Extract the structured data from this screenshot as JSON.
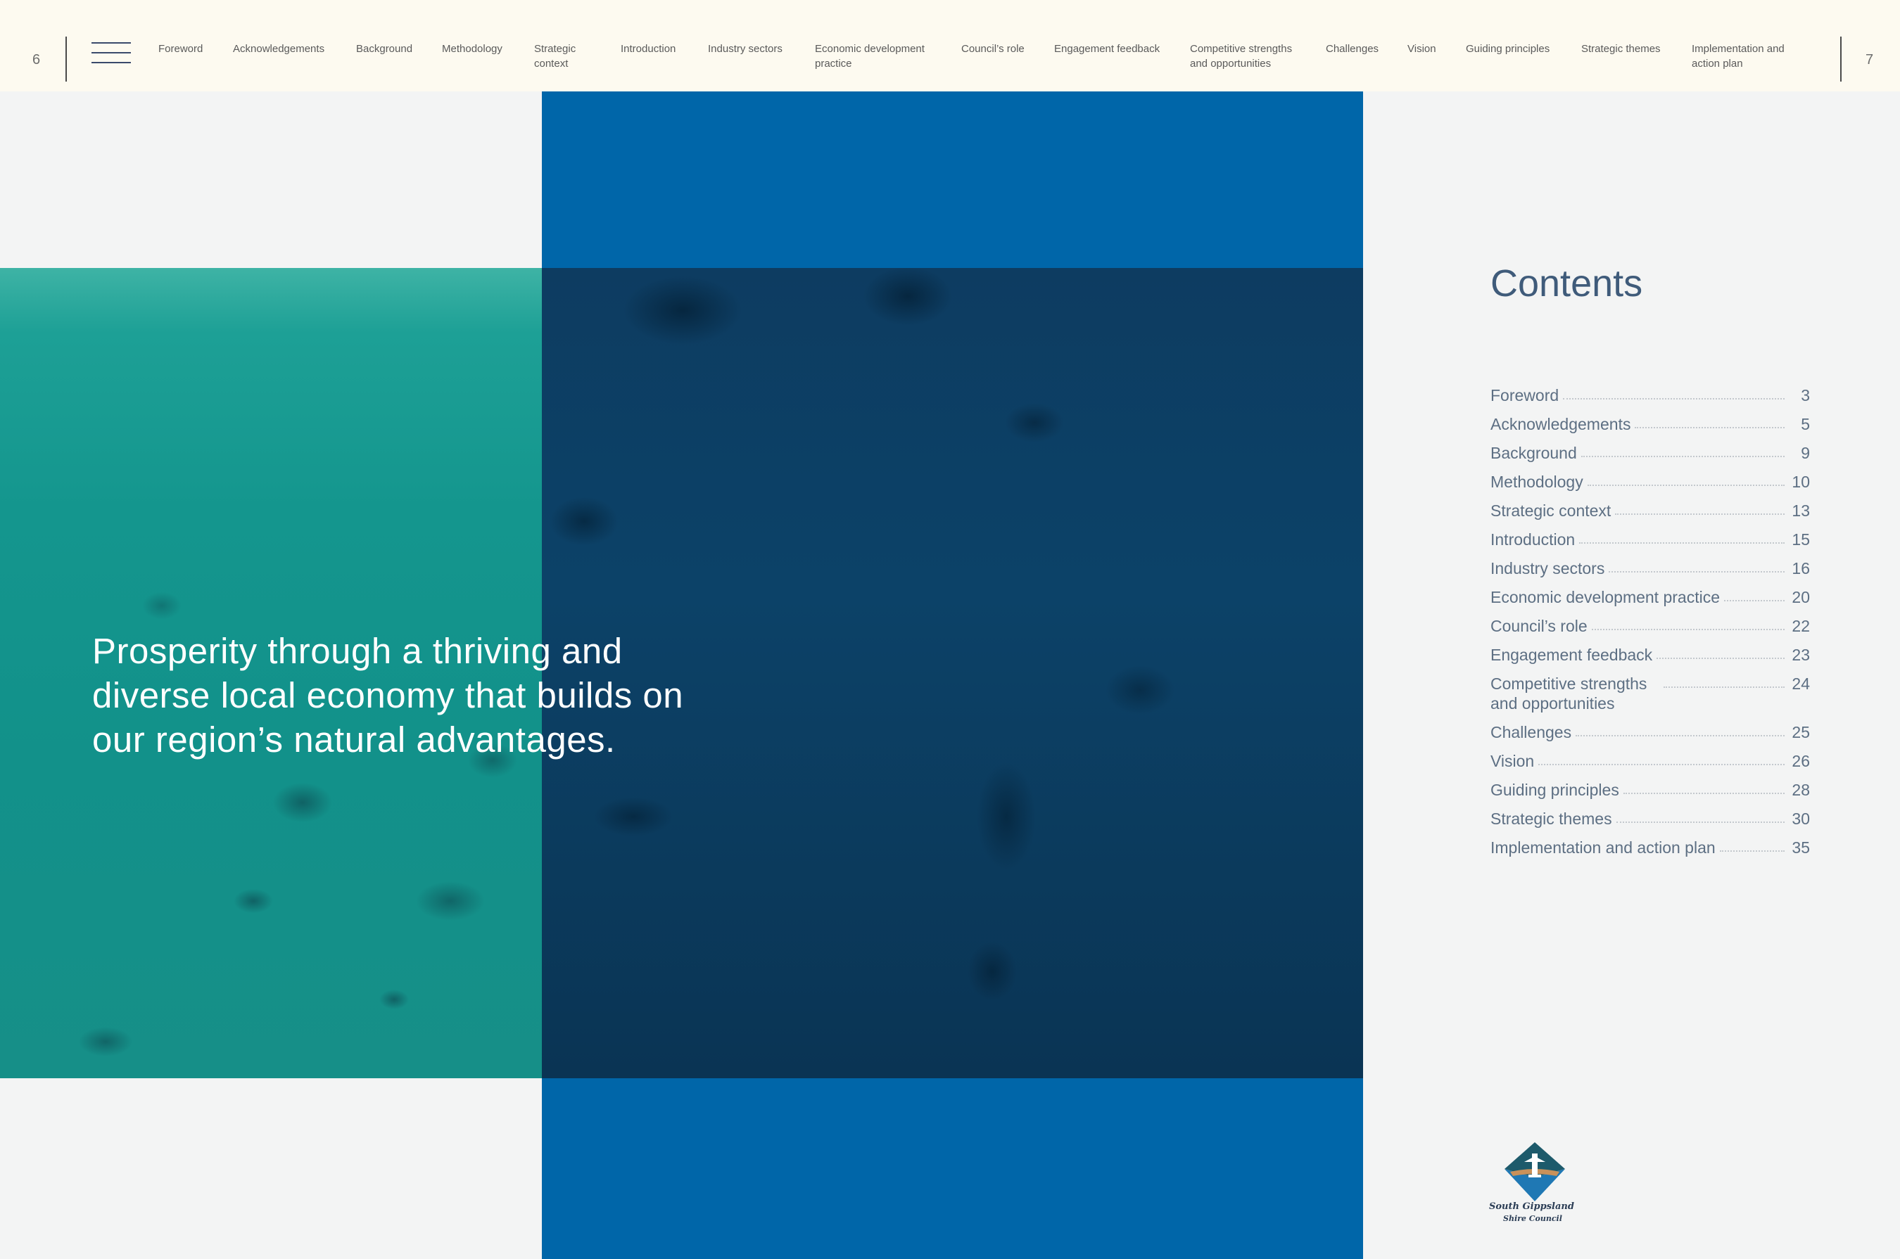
{
  "header": {
    "page_left": "6",
    "page_right": "7",
    "menu_icon": "hamburger-menu-icon",
    "nav": [
      {
        "label": "Foreword"
      },
      {
        "label": "Acknowledgements"
      },
      {
        "label": "Background"
      },
      {
        "label": "Methodology"
      },
      {
        "label": "Strategic context"
      },
      {
        "label": "Introduction"
      },
      {
        "label": "Industry sectors"
      },
      {
        "label": "Economic development practice"
      },
      {
        "label": "Council’s role"
      },
      {
        "label": "Engagement feedback"
      },
      {
        "label": "Competitive strengths and opportunities"
      },
      {
        "label": "Challenges"
      },
      {
        "label": "Vision"
      },
      {
        "label": "Guiding principles"
      },
      {
        "label": "Strategic themes"
      },
      {
        "label": "Implementation and action plan"
      }
    ]
  },
  "hero": {
    "headline": "Prosperity through a thriving and diverse local economy that builds on our region’s natural advantages."
  },
  "contents": {
    "title": "Contents",
    "items": [
      {
        "label": "Foreword",
        "page": "3"
      },
      {
        "label": "Acknowledgements",
        "page": "5"
      },
      {
        "label": "Background",
        "page": "9"
      },
      {
        "label": "Methodology",
        "page": "10"
      },
      {
        "label": "Strategic context",
        "page": "13"
      },
      {
        "label": "Introduction",
        "page": "15"
      },
      {
        "label": "Industry sectors",
        "page": "16"
      },
      {
        "label": "Economic development practice",
        "page": "20"
      },
      {
        "label": "Council’s role",
        "page": "22"
      },
      {
        "label": "Engagement feedback",
        "page": "23"
      },
      {
        "label": "Competitive strengths and opportunities",
        "page": "24"
      },
      {
        "label": "Challenges",
        "page": "25"
      },
      {
        "label": "Vision",
        "page": "26"
      },
      {
        "label": "Guiding principles",
        "page": "28"
      },
      {
        "label": "Strategic themes",
        "page": "30"
      },
      {
        "label": "Implementation and action plan",
        "page": "35"
      }
    ]
  },
  "logo": {
    "line1": "South Gippsland",
    "line2": "Shire Council"
  },
  "colors": {
    "header_bg": "#fdfaf0",
    "page_bg": "#f3f4f4",
    "accent_blue": "#0066a9",
    "teal_water": "#14968e",
    "deep_water": "#0c4268",
    "contents_text": "#5d6f83"
  }
}
